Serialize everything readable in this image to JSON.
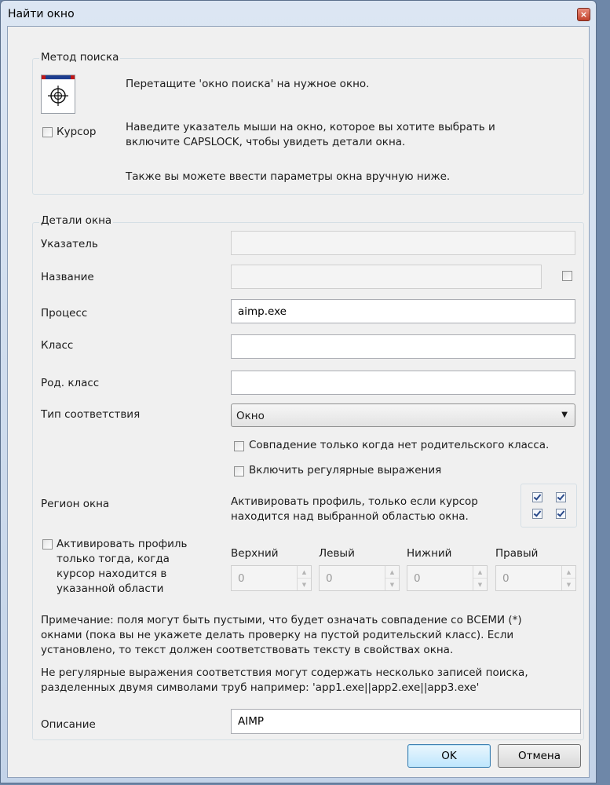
{
  "window": {
    "title": "Найти окно",
    "close_symbol": "×"
  },
  "search_method": {
    "legend": "Метод поиска",
    "finder_icon": "crosshair-finder-icon",
    "drag_hint": "Перетащите 'окно поиска' на нужное окно.",
    "cursor_checkbox": {
      "label": "Курсор",
      "checked": false
    },
    "hover_hint_line1": "Наведите указатель мыши на окно, которое вы хотите выбрать и",
    "hover_hint_line2": "включите CAPSLOCK, чтобы увидеть детали окна.",
    "manual_hint": "Также вы можете ввести параметры окна вручную ниже."
  },
  "details": {
    "legend": "Детали окна",
    "pointer": {
      "label": "Указатель",
      "value": ""
    },
    "name": {
      "label": "Название",
      "value": "",
      "checked": false
    },
    "process": {
      "label": "Процесс",
      "value": "aimp.exe"
    },
    "class": {
      "label": "Класс",
      "value": ""
    },
    "parent_class": {
      "label": "Род. класс",
      "value": ""
    },
    "match_type": {
      "label": "Тип соответствия",
      "selected": "Окно"
    },
    "only_no_parent": {
      "label": "Совпадение только когда нет родительского класса.",
      "checked": false
    },
    "regex": {
      "label": "Включить регулярные выражения",
      "checked": false
    },
    "region": {
      "label": "Регион окна",
      "text_line1": "Активировать профиль, только если курсор",
      "text_line2": "находится над выбранной областью окна.",
      "quadrants": [
        true,
        true,
        true,
        true
      ]
    },
    "activate_area": {
      "checked": false,
      "label_line1": "Активировать профиль",
      "label_line2": "только тогда, когда",
      "label_line3": "курсор находится в",
      "label_line4": "указанной области"
    },
    "bounds": [
      {
        "label": "Верхний",
        "value": "0"
      },
      {
        "label": "Левый",
        "value": "0"
      },
      {
        "label": "Нижний",
        "value": "0"
      },
      {
        "label": "Правый",
        "value": "0"
      }
    ],
    "note_line1": "Примечание: поля могут быть пустыми, что будет означать совпадение со ВСЕМИ (*)",
    "note_line2": "окнами (пока вы не укажете делать проверку на пустой родительский класс). Если",
    "note_line3": "установлено, то текст должен соответствовать тексту в свойствах окна.",
    "regex_note_line1": "Не регулярные выражения соответствия могут содержать несколько записей поиска,",
    "regex_note_line2": "разделенных двумя символами труб например: 'app1.exe||app2.exe||app3.exe'"
  },
  "description": {
    "label": "Описание",
    "value": "AIMP"
  },
  "buttons": {
    "ok": "OK",
    "cancel": "Отмена"
  },
  "dropdown_arrow": "▼"
}
